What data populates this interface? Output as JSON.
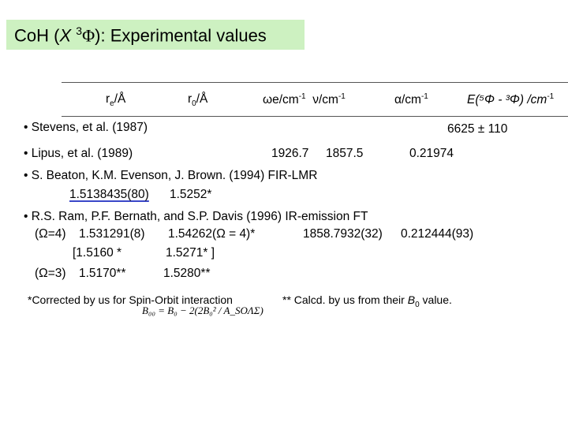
{
  "title": {
    "prefix": "CoH (",
    "state_x": "X",
    "state_sup": "3",
    "state_phi": "Φ",
    "suffix": "):  Experimental values"
  },
  "headers": {
    "re": "r",
    "re_sub": "e",
    "re_unit": "/Å",
    "r0": "r",
    "r0_sub": "0",
    "r0_unit": "/Å",
    "omega_e": "ωe/cm",
    "omega_e_sup": "-1",
    "nu": "ν/cm",
    "nu_sup": "-1",
    "alpha": "α/cm",
    "alpha_sup": "-1",
    "energy": "E(⁵Φ - ³Φ) /cm",
    "energy_sup": "-1"
  },
  "rows": {
    "stevens": {
      "label": "• Stevens, et al. (1987)",
      "value": "6625 ± 110"
    },
    "lipus": {
      "label": "• Lipus, et al. (1989)",
      "omega": "1926.7",
      "nu": "1857.5",
      "alpha": "0.21974"
    },
    "beaton": {
      "label": "• S. Beaton, K.M. Evenson, J. Brown. (1994)   FIR-LMR",
      "re": "1.5138435(80)",
      "r0": "1.5252*"
    },
    "ram": {
      "label": "• R.S. Ram, P.F. Bernath, and S.P. Davis (1996)   IR-emission FT",
      "omega4_label": "(Ω=4)",
      "omega4_re": "1.531291(8)",
      "omega4_r0": "1.54262(Ω = 4)*",
      "omega4_nu": "1858.7932(32)",
      "omega4_alpha": "0.212444(93)",
      "bracket_re": "[1.5160 *",
      "bracket_r0": "1.5271* ]",
      "omega3_label": "(Ω=3)",
      "omega3_re": "1.5170**",
      "omega3_r0": "1.5280**"
    }
  },
  "footnotes": {
    "note1": "*Corrected by us for Spin-Orbit interaction",
    "note2_prefix": "** Calcd. by us from their ",
    "note2_b": "B",
    "note2_sub": "0",
    "note2_suffix": " value.",
    "formula": "B₀₀ = B₀ − 2(2B₀² / A_SOΛΣ)"
  }
}
